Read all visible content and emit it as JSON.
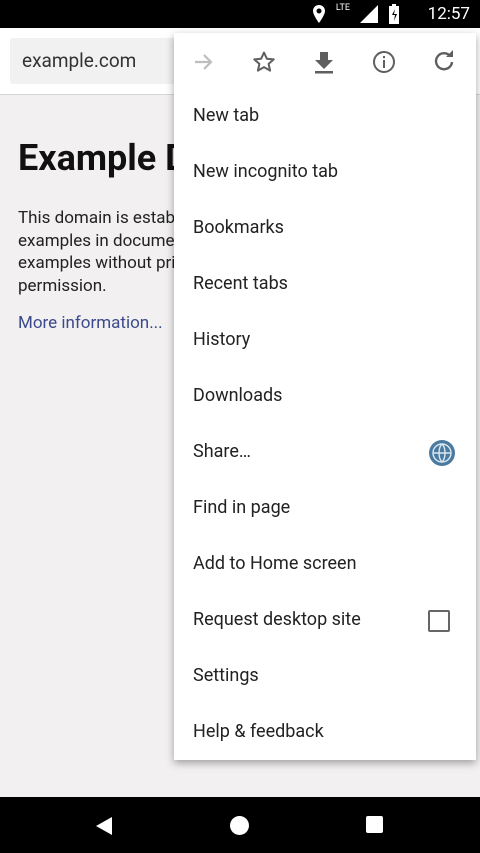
{
  "status_bar": {
    "time": "12:57",
    "network": "LTE"
  },
  "toolbar": {
    "url": "example.com"
  },
  "page": {
    "heading": "Example Domain",
    "body": "This domain is established to be used for illustrative examples in documents. You may use this domain in examples without prior coordination or asking for permission.",
    "link": "More information..."
  },
  "menu": {
    "top_icons": [
      "forward-arrow-icon",
      "star-icon",
      "download-icon",
      "info-icon",
      "refresh-icon"
    ],
    "items": [
      {
        "label": "New tab"
      },
      {
        "label": "New incognito tab"
      },
      {
        "label": "Bookmarks"
      },
      {
        "label": "Recent tabs"
      },
      {
        "label": "History"
      },
      {
        "label": "Downloads"
      },
      {
        "label": "Share…",
        "icon": "share-globe-icon"
      },
      {
        "label": "Find in page"
      },
      {
        "label": "Add to Home screen"
      },
      {
        "label": "Request desktop site",
        "checkbox": false
      },
      {
        "label": "Settings"
      },
      {
        "label": "Help & feedback"
      }
    ]
  },
  "nav": {
    "back": "back-icon",
    "home": "home-icon",
    "recents": "recents-icon"
  },
  "colors": {
    "link": "#3a4a8c",
    "share_icon": "#4a7aa0"
  }
}
